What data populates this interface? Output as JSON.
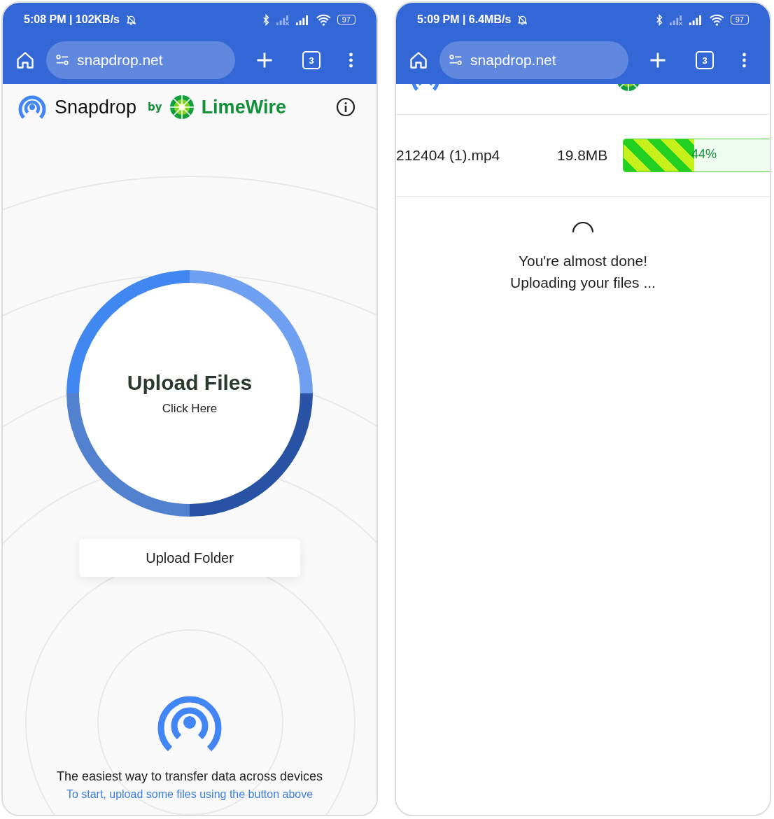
{
  "screens": [
    {
      "kind": "home",
      "status_bar": {
        "time": "5:08 PM | 102KB/s",
        "battery": "97"
      },
      "address_bar": {
        "url": "snapdrop.net"
      },
      "tab_count": "3",
      "header": {
        "brand": "Snapdrop",
        "by": "by",
        "partner": "LimeWire"
      },
      "upload": {
        "title": "Upload Files",
        "subtitle": "Click Here"
      },
      "folder_button": "Upload Folder",
      "tagline": "The easiest way to transfer data across devices",
      "hint": "To start, upload some files using the button above"
    },
    {
      "kind": "progress",
      "status_bar": {
        "time": "5:09 PM | 6.4MB/s",
        "battery": "97"
      },
      "address_bar": {
        "url": "snapdrop.net"
      },
      "tab_count": "3",
      "file": {
        "name": "212404 (1).mp4",
        "size": "19.8MB",
        "level": 0.44,
        "percent": "44%"
      },
      "messages": [
        "You're almost done!",
        "Uploading your files ..."
      ]
    }
  ]
}
